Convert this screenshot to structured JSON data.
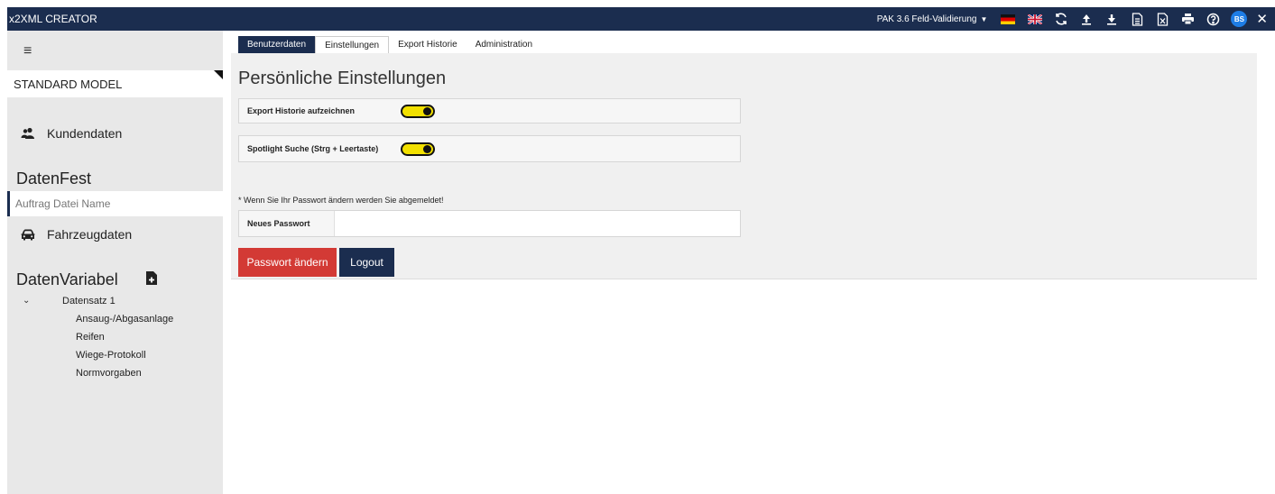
{
  "app": {
    "title": "x2XML CREATOR"
  },
  "toolbar": {
    "version_label": "PAK 3.6 Feld-Validierung",
    "user_initials": "BS",
    "icons": [
      "refresh-icon",
      "upload-icon",
      "download-icon",
      "document-icon",
      "excel-icon",
      "print-icon",
      "help-icon"
    ]
  },
  "sidebar": {
    "model_label": "STANDARD MODEL",
    "customer_label": "Kundendaten",
    "fixed_section": "DatenFest",
    "file_name_placeholder": "Auftrag Datei Name",
    "vehicle_label": "Fahrzeugdaten",
    "variable_section": "DatenVariabel",
    "tree": {
      "root": "Datensatz 1",
      "children": [
        "Ansaug-/Abgasanlage",
        "Reifen",
        "Wiege-Protokoll",
        "Normvorgaben"
      ]
    }
  },
  "tabs": [
    "Benutzerdaten",
    "Einstellungen",
    "Export Historie",
    "Administration"
  ],
  "active_tab": "Einstellungen",
  "settings": {
    "title": "Persönliche Einstellungen",
    "export_history_label": "Export Historie aufzeichnen",
    "export_history_on": true,
    "spotlight_label": "Spotlight Suche (Strg + Leertaste)",
    "spotlight_on": true,
    "password_note": "* Wenn Sie Ihr Passwort ändern werden Sie abgemeldet!",
    "new_password_label": "Neues Passwort",
    "new_password_value": "",
    "change_password_button": "Passwort ändern",
    "logout_button": "Logout"
  },
  "colors": {
    "navy": "#1b2d4f",
    "toggle_on": "#f2e000",
    "danger": "#d33a35",
    "avatar": "#1e7de6"
  }
}
